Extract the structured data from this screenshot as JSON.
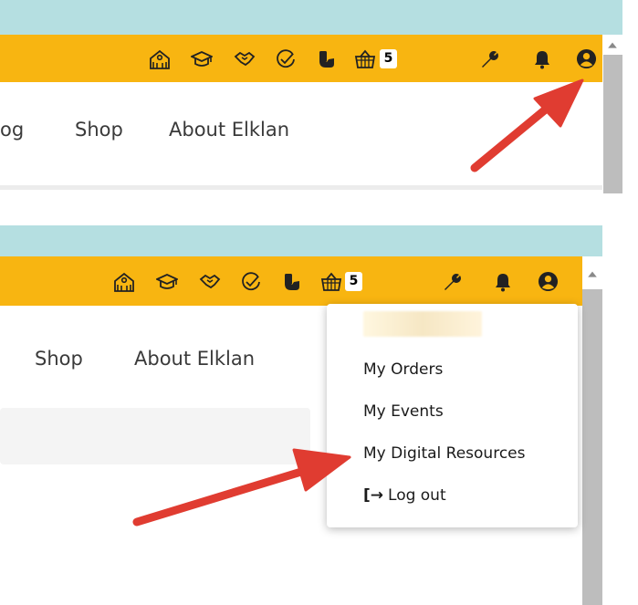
{
  "top": {
    "nav": {
      "blog_partial": "og",
      "shop": "Shop",
      "about": "About Elklan"
    },
    "basket_count": "5"
  },
  "bottom": {
    "nav": {
      "shop": "Shop",
      "about": "About Elklan"
    },
    "basket_count": "5",
    "menu": {
      "items": [
        "My Orders",
        "My Events",
        "My Digital Resources",
        "Log out"
      ],
      "logout_glyph": "[→"
    }
  },
  "colors": {
    "header_bar": "#f8b511",
    "browser_bar": "#b5dfe1",
    "arrow": "#e03c31"
  },
  "icons": [
    "school-icon",
    "graduation-cap-icon",
    "handshake-icon",
    "check-circle-icon",
    "phone-hand-icon",
    "basket-icon",
    "wrench-icon",
    "bell-icon",
    "user-circle-icon"
  ]
}
